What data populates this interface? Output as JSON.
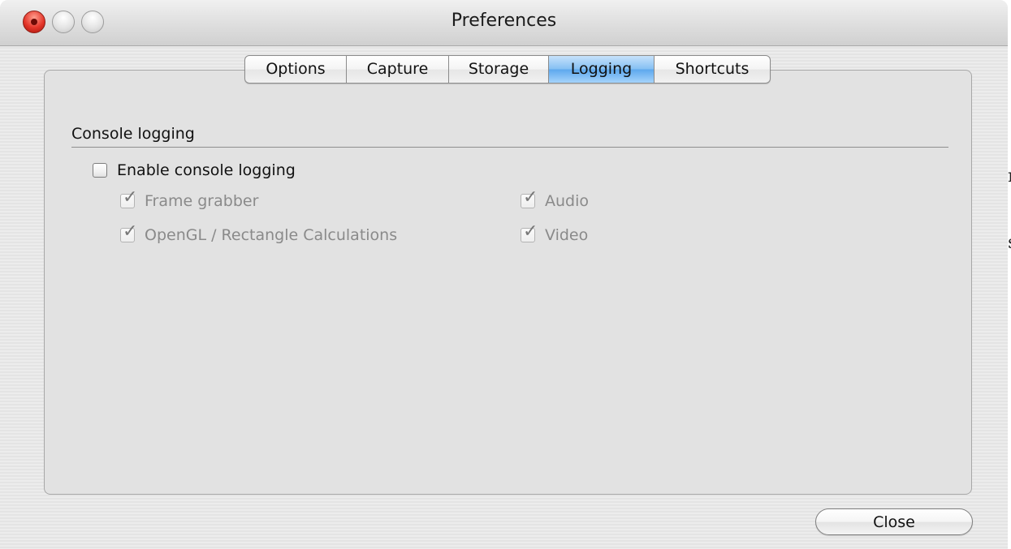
{
  "window": {
    "title": "Preferences"
  },
  "titlebar": {
    "buttons": [
      "close-icon",
      "minimize-icon",
      "zoom-icon"
    ]
  },
  "tabs": {
    "items": [
      {
        "label": "Options"
      },
      {
        "label": "Capture"
      },
      {
        "label": "Storage"
      },
      {
        "label": "Logging"
      },
      {
        "label": "Shortcuts"
      }
    ],
    "selected": "Logging",
    "selected_color": "#6fb2f0"
  },
  "logging": {
    "section_label": "Console logging",
    "enable": {
      "label": "Enable console logging",
      "checked": false
    },
    "options": [
      {
        "label": "Frame grabber",
        "checked": true,
        "enabled": false
      },
      {
        "label": "Audio",
        "checked": true,
        "enabled": false
      },
      {
        "label": "OpenGL / Rectangle Calculations",
        "checked": true,
        "enabled": false
      },
      {
        "label": "Video",
        "checked": true,
        "enabled": false
      }
    ]
  },
  "footer": {
    "close_label": "Close"
  },
  "edge_glyphs": {
    "first": "n",
    "second": "s"
  }
}
